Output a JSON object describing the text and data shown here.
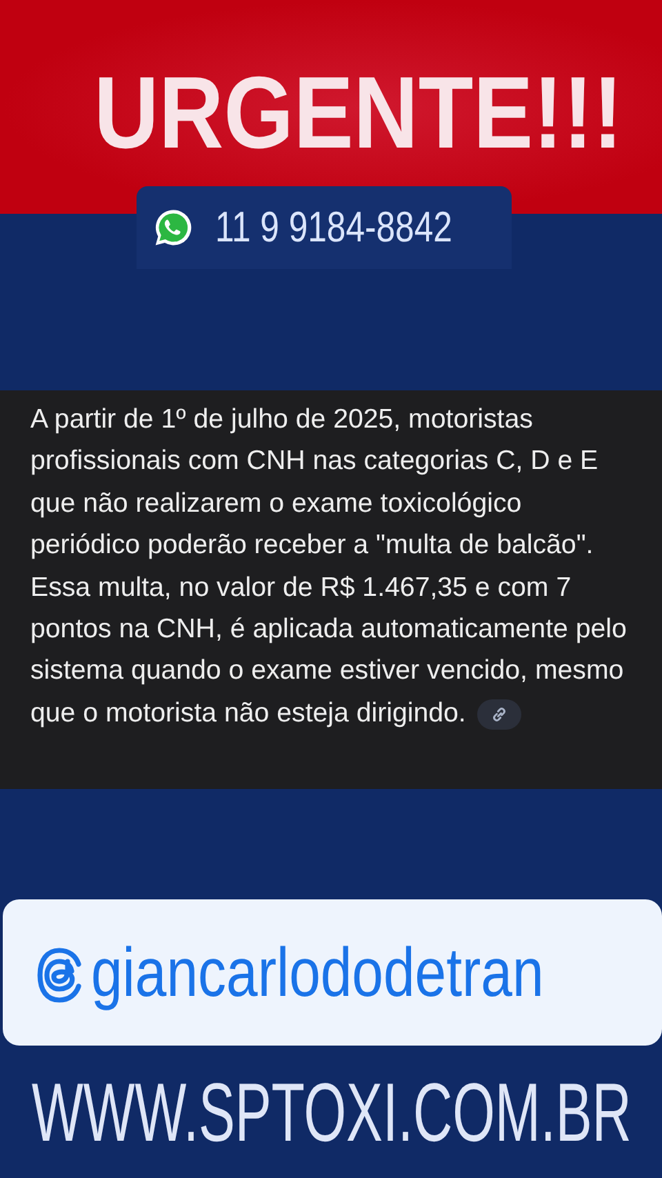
{
  "headline": "URGENTE!!!",
  "phone": "11 9 9184-8842",
  "notice": {
    "text": "A partir de 1º de julho de 2025, motoristas profissionais com CNH nas categorias C, D e E que não realizarem o exame toxicológico periódico poderão receber a \"multa de balcão\". Essa multa, no valor de R$ 1.467,35 e com 7 pontos na CNH, é aplicada automaticamente pelo sistema quando o exame estiver vencido, mesmo que o motorista não esteja dirigindo."
  },
  "handle": "giancarlododetran",
  "website": "WWW.SPTOXI.COM.BR"
}
